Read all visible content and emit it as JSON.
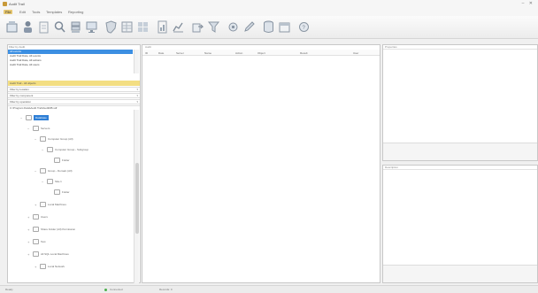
{
  "window": {
    "title": "Audit Trail",
    "controls": [
      "–",
      "✕"
    ]
  },
  "menu": [
    "File",
    "Edit",
    "Tools",
    "Templates",
    "Reporting"
  ],
  "ribbon_icons": [
    "folder-icon",
    "user-icon",
    "document-icon",
    "search-icon",
    "server-icon",
    "monitor-icon",
    "shield-icon",
    "table-icon",
    "grid-icon",
    "report-icon",
    "chart-icon",
    "export-icon",
    "filter-icon",
    "settings-icon",
    "edit-icon",
    "database-icon",
    "calendar-icon",
    "help-icon"
  ],
  "left_panel": {
    "header": "Filter by Audit",
    "list_rows": [
      "All events",
      "Audit Trail Date, All events",
      "Audit Trail Date, All actions",
      "Audit Trail Date, All users"
    ],
    "highlight": "Audit Trail - All objects",
    "fields": [
      "Filter by location",
      "Filter by component",
      "Filter by operation"
    ],
    "path": "C:\\Program Data\\Audit Trail\\AuditDB.sdf",
    "tree": [
      {
        "label": "Database",
        "indent": 1,
        "selected": true
      },
      {
        "label": "Servers",
        "indent": 2
      },
      {
        "label": "Computer Group (All)",
        "indent": 3
      },
      {
        "label": "Computer Group - Subgroup",
        "indent": 4
      },
      {
        "label": "Folder",
        "indent": 5
      },
      {
        "label": "Group - Domain (All)",
        "indent": 3
      },
      {
        "label": "Site-1",
        "indent": 4
      },
      {
        "label": "Folder",
        "indent": 5
      },
      {
        "label": "Local Machines",
        "indent": 3
      },
      {
        "label": "Users",
        "indent": 2
      },
      {
        "label": "Share Folder (All) Permission",
        "indent": 2
      },
      {
        "label": "Test",
        "indent": 2
      },
      {
        "label": "All SQL Local Machines",
        "indent": 2
      },
      {
        "label": "Local Network",
        "indent": 3
      }
    ]
  },
  "middle_panel": {
    "header": "Audit",
    "columns": [
      "ID",
      "Date",
      "Server",
      "Name",
      "Action",
      "Object",
      "Result",
      "User"
    ]
  },
  "right_panel": {
    "top_header": "Properties",
    "bottom_header": "Description"
  },
  "status": {
    "left": "Ready",
    "connected": "Connected",
    "middle": "Records: 0"
  }
}
